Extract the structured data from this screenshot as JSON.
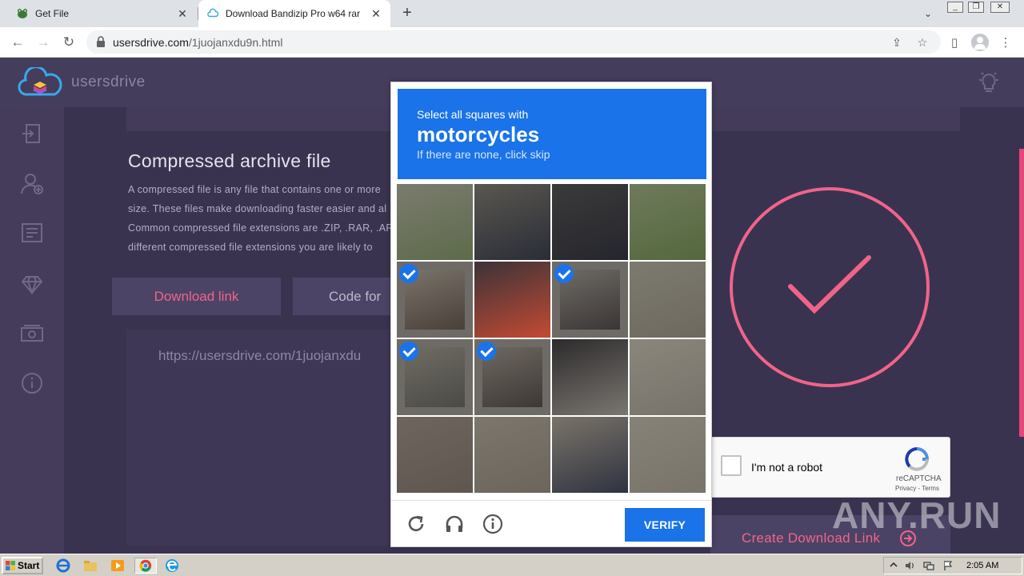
{
  "browser": {
    "tabs": [
      {
        "title": "Get File",
        "close": "✕"
      },
      {
        "title": "Download Bandizip Pro w64 rar",
        "close": "✕"
      }
    ],
    "new_tab": "+",
    "tab_menu": "⌄",
    "url_host": "usersdrive.com",
    "url_path": "/1juojanxdu9n.html"
  },
  "site": {
    "brand": "usersdrive",
    "heading": "Compressed archive file",
    "paragraph": [
      "A compressed file is any file that contains one or more",
      "size. These files make downloading faster easier and al",
      "Common compressed file extensions are .ZIP, .RAR, .AR",
      "different compressed file extensions you are likely to"
    ],
    "download_link_label": "Download link",
    "code_for_label": "Code for",
    "file_url": "https://usersdrive.com/1juojanxdu",
    "create_link_label": "Create Download Link",
    "colors": {
      "accent": "#f0648a",
      "bg": "#3b3352",
      "blue": "#1a73e8"
    }
  },
  "recaptcha_anchor": {
    "label": "I'm not a robot",
    "brand": "reCAPTCHA",
    "terms": "Privacy - Terms"
  },
  "challenge": {
    "line1": "Select all squares with",
    "target": "motorcycles",
    "line3": "If there are none, click skip",
    "selected_tiles": [
      4,
      6,
      8,
      9
    ],
    "verify_label": "VERIFY",
    "icons": [
      "reload-icon",
      "audio-icon",
      "info-icon"
    ]
  },
  "watermark": "ANY.RUN",
  "taskbar": {
    "start_label": "Start",
    "clock": "2:05 AM"
  }
}
